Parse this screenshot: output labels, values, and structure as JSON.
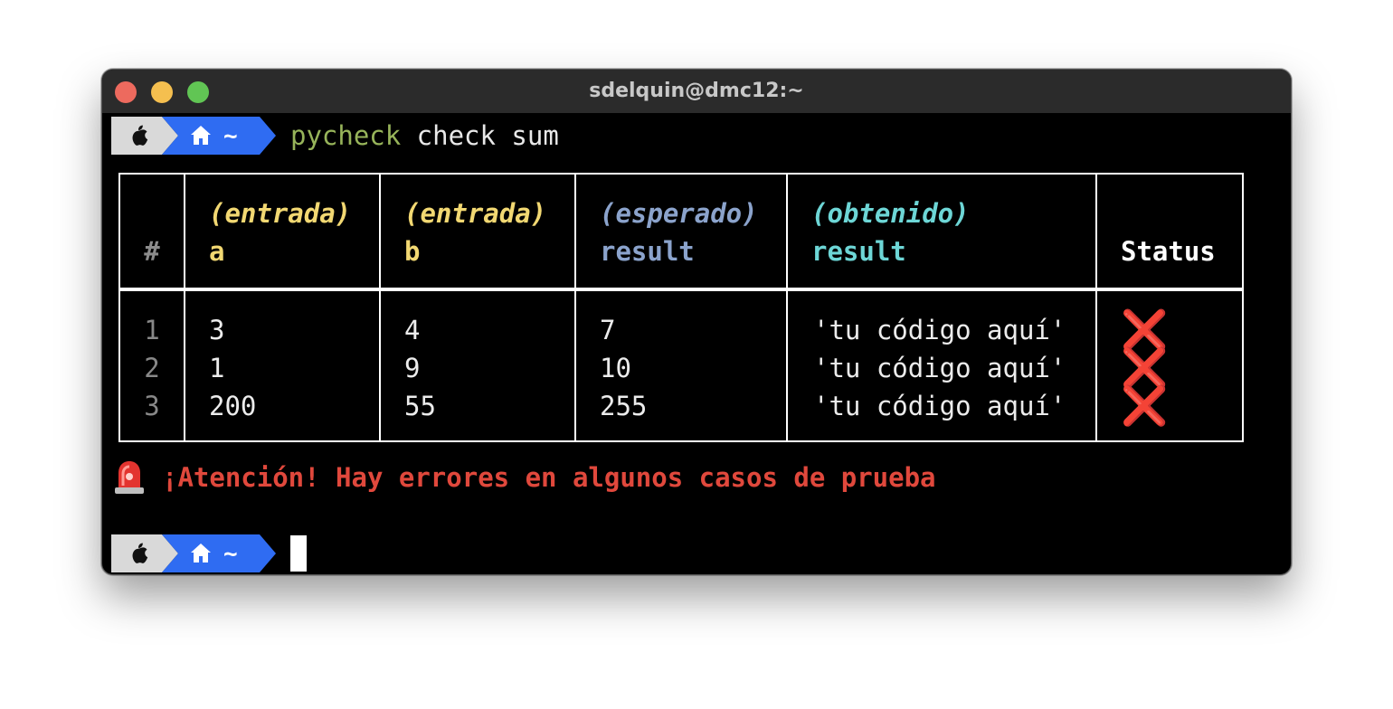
{
  "window": {
    "title": "sdelquin@dmc12:~"
  },
  "prompt": {
    "home_symbol": "~"
  },
  "command": {
    "program": "pycheck",
    "args": " check sum"
  },
  "table": {
    "headers": {
      "num": "#",
      "a_tag": "(entrada)",
      "a_name": "a",
      "b_tag": "(entrada)",
      "b_name": "b",
      "expected_tag": "(esperado)",
      "expected_name": "result",
      "obtained_tag": "(obtenido)",
      "obtained_name": "result",
      "status": "Status"
    },
    "rows": [
      {
        "num": "1",
        "a": "3",
        "b": "4",
        "expected": "7",
        "obtained": "'tu código aquí'",
        "status": "❌"
      },
      {
        "num": "2",
        "a": "1",
        "b": "9",
        "expected": "10",
        "obtained": "'tu código aquí'",
        "status": "❌"
      },
      {
        "num": "3",
        "a": "200",
        "b": "55",
        "expected": "255",
        "obtained": "'tu código aquí'",
        "status": "❌"
      }
    ]
  },
  "warning": {
    "icon": "siren-icon",
    "text": "¡Atención! Hay errores en algunos casos de prueba"
  },
  "colors": {
    "terminal_bg": "#000000",
    "titlebar_bg": "#2b2b2b",
    "prompt_segment_1": "#d9d9d9",
    "prompt_segment_2": "#2f6cf2",
    "program": "#97b45a",
    "input_header": "#f2d872",
    "expected_header": "#8ba3cc",
    "obtained_header": "#6dd6d6",
    "error": "#e0483c",
    "fail_mark": "#e0251b"
  }
}
